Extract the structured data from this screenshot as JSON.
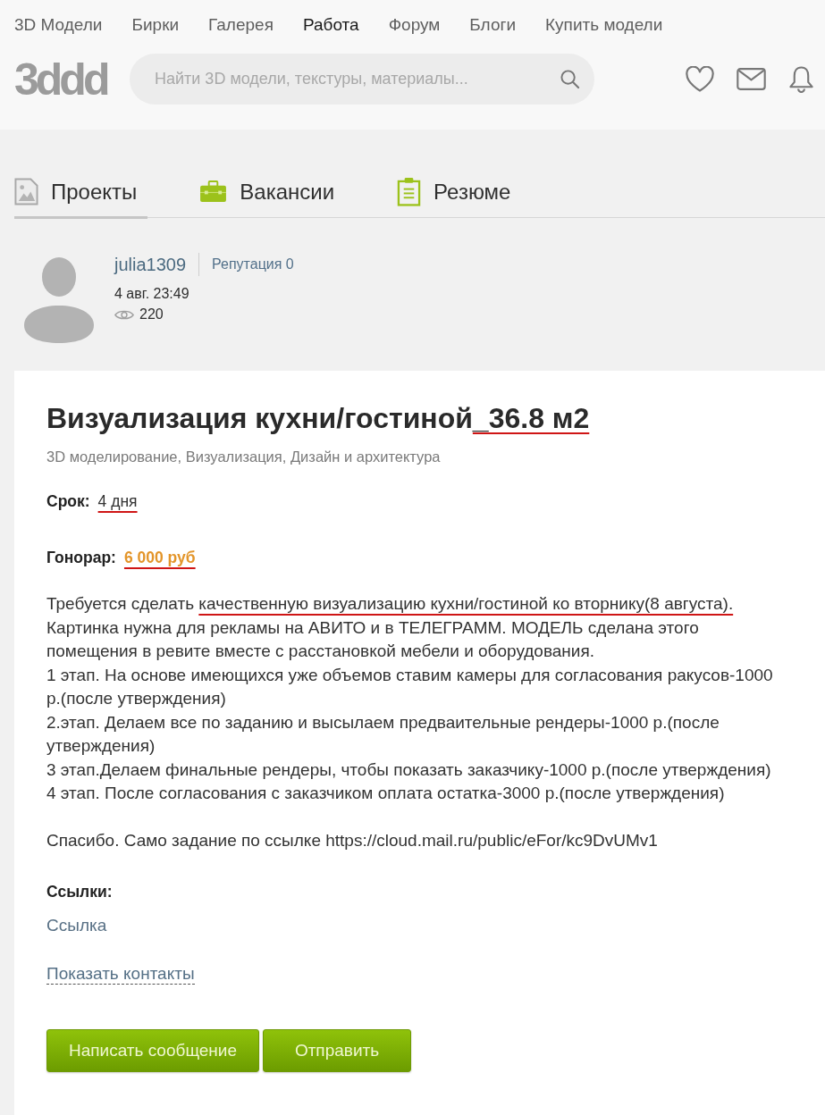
{
  "top_nav": [
    {
      "label": "3D Модели",
      "selected": false
    },
    {
      "label": "Бирки",
      "selected": false
    },
    {
      "label": "Галерея",
      "selected": false
    },
    {
      "label": "Работа",
      "selected": true
    },
    {
      "label": "Форум",
      "selected": false
    },
    {
      "label": "Блоги",
      "selected": false
    },
    {
      "label": "Купить модели",
      "selected": false
    }
  ],
  "header": {
    "logo": "3ddd",
    "search": {
      "placeholder": "Найти 3D модели, текстуры, материалы..."
    }
  },
  "tabs": [
    {
      "label": "Проекты",
      "selected": true
    },
    {
      "label": "Вакансии",
      "selected": false
    },
    {
      "label": "Резюме",
      "selected": false
    }
  ],
  "author": {
    "username": "julia1309",
    "reputation": "Репутация 0",
    "date": "4 авг. 23:49",
    "views": "220"
  },
  "job": {
    "title": [
      {
        "text": "Визуализация кухни/гостиной",
        "marked": false
      },
      {
        "text": "_36.8 м2",
        "marked": true
      }
    ],
    "categories": "3D моделирование, Визуализация, Дизайн и архитектура",
    "fields": [
      {
        "kind": "term",
        "label": "Срок:",
        "value": "4 дня",
        "marked": true
      },
      {
        "kind": "price",
        "label": "Гонорар:",
        "value": "6 000 руб",
        "marked": true
      }
    ],
    "description": [
      {
        "parts": [
          {
            "text": "Требуется сделать ",
            "marked": false
          },
          {
            "text": "качественную визуализацию кухни/гостиной ко вторнику(8 августа).",
            "marked": true
          }
        ]
      },
      {
        "parts": [
          {
            "text": "Картинка нужна для рекламы на АВИТО и в ТЕЛЕГРАММ. МОДЕЛЬ сделана этого помещения в ревите вместе с расстановкой мебели и оборудования.",
            "marked": false
          }
        ]
      },
      {
        "parts": [
          {
            "text": "1 этап. На основе имеющихся уже объемов ставим камеры для согласования ракусов-1000 р.(после утверждения)",
            "marked": false
          }
        ]
      },
      {
        "parts": [
          {
            "text": "2.этап. Делаем все по заданию и высылаем предваительные рендеры-1000 р.(после утверждения)",
            "marked": false
          }
        ]
      },
      {
        "parts": [
          {
            "text": "3 этап.Делаем финальные рендеры, чтобы показать заказчику-1000 р.(после утверждения)",
            "marked": false
          }
        ]
      },
      {
        "parts": [
          {
            "text": "4 этап. После согласования с заказчиком оплата остатка-3000 р.(после утверждения)",
            "marked": false
          }
        ]
      }
    ],
    "closing": "Спасибо. Само задание по ссылке https://cloud.mail.ru/public/eFor/kc9DvUMv1",
    "links_label": "Ссылки:",
    "links": [
      "Ссылка"
    ],
    "show_contacts": "Показать контакты",
    "buttons": [
      "Написать сообщение",
      "Отправить"
    ]
  }
}
